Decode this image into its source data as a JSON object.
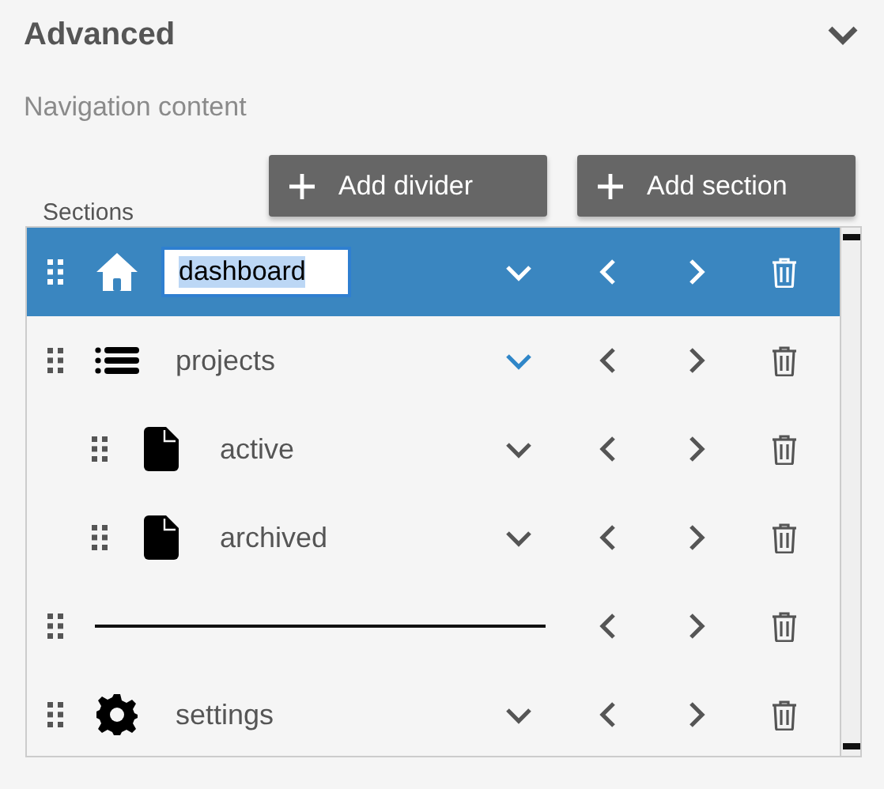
{
  "panel": {
    "title": "Advanced"
  },
  "subtitle": "Navigation content",
  "sections_label": "Sections",
  "buttons": [
    {
      "label": "Add divider"
    },
    {
      "label": "Add section"
    }
  ],
  "items": [
    {
      "kind": "home",
      "label": "dashboard",
      "selected": true,
      "expanded": false
    },
    {
      "kind": "list",
      "label": "projects",
      "selected": false,
      "expanded": true,
      "children": [
        {
          "kind": "page",
          "label": "active",
          "selected": false,
          "expanded": false
        },
        {
          "kind": "page",
          "label": "archived",
          "selected": false,
          "expanded": false
        }
      ]
    },
    {
      "kind": "divider",
      "selected": false
    },
    {
      "kind": "gear",
      "label": "settings",
      "selected": false,
      "expanded": false
    }
  ]
}
